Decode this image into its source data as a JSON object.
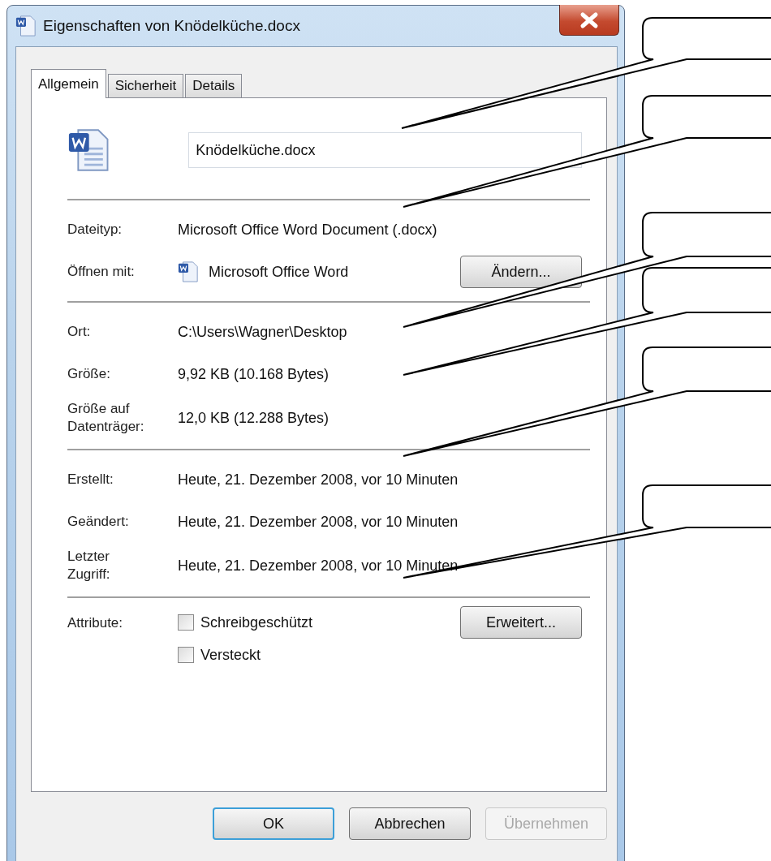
{
  "window": {
    "title": "Eigenschaften von Knödelküche.docx"
  },
  "tabs": [
    {
      "label": "Allgemein",
      "selected": true
    },
    {
      "label": "Sicherheit",
      "selected": false
    },
    {
      "label": "Details",
      "selected": false
    }
  ],
  "file_name": {
    "value": "Knödelküche.docx"
  },
  "sections": [
    {
      "rows": [
        {
          "label": "Dateityp:",
          "value": "Microsoft Office Word Document (.docx)"
        },
        {
          "label": "Öffnen mit:",
          "value": "Microsoft Office Word",
          "kind": "app",
          "button": "Ändern..."
        }
      ]
    },
    {
      "rows": [
        {
          "label": "Ort:",
          "value": "C:\\Users\\Wagner\\Desktop"
        },
        {
          "label": "Größe:",
          "value": "9,92 KB (10.168 Bytes)"
        },
        {
          "label": "Größe auf Datenträger:",
          "value": "12,0 KB (12.288 Bytes)",
          "kind": "tall"
        }
      ]
    },
    {
      "rows": [
        {
          "label": "Erstellt:",
          "value": "Heute, 21. Dezember 2008, vor 10 Minuten"
        },
        {
          "label": "Geändert:",
          "value": "Heute, 21. Dezember 2008, vor 10 Minuten"
        },
        {
          "label": "Letzter Zugriff:",
          "value": "Heute, 21. Dezember 2008, vor 10 Minuten",
          "kind": "tall"
        }
      ]
    }
  ],
  "attributes": {
    "label": "Attribute:",
    "options": [
      {
        "label": "Schreibgeschützt",
        "checked": false
      },
      {
        "label": "Versteckt",
        "checked": false
      }
    ],
    "button": "Erweitert..."
  },
  "buttons": [
    {
      "label": "OK",
      "default": true,
      "disabled": false
    },
    {
      "label": "Abbrechen",
      "default": false,
      "disabled": false
    },
    {
      "label": "Übernehmen",
      "default": false,
      "disabled": true
    }
  ]
}
